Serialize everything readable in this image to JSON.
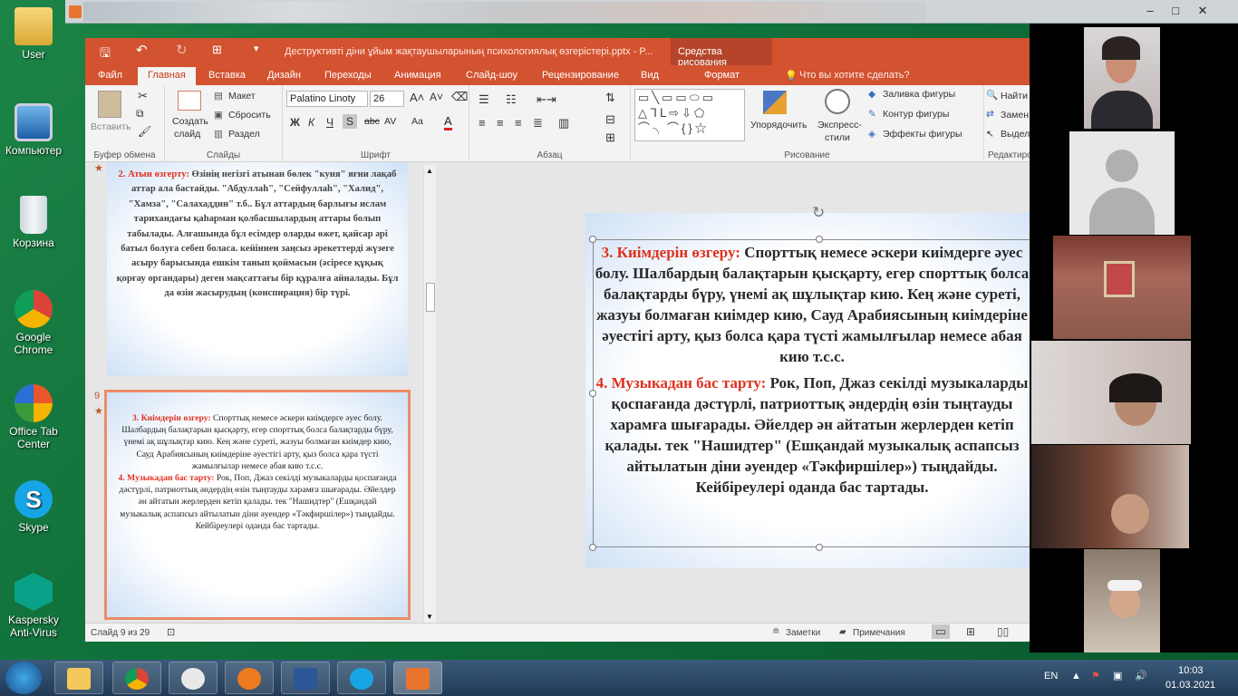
{
  "desktop": {
    "icons": [
      {
        "label": "User"
      },
      {
        "label": "Компьютер"
      },
      {
        "label": "Корзина"
      },
      {
        "label": "Google\nChrome"
      },
      {
        "label": "Office Tab\nCenter"
      },
      {
        "label": "Skype"
      },
      {
        "label": "Kaspersky\nAnti-Virus"
      }
    ]
  },
  "ppt": {
    "doc_title": "Деструктивті діни ұйым жақтаушыларының психологиялық өзгерістері.pptx - P...",
    "context_group": "Средства рисования",
    "tabs": [
      "Файл",
      "Главная",
      "Вставка",
      "Дизайн",
      "Переходы",
      "Анимация",
      "Слайд-шоу",
      "Рецензирование",
      "Вид",
      "Формат"
    ],
    "tell_me": "Что вы хотите сделать?",
    "ribbon": {
      "clipboard": {
        "paste": "Вставить",
        "label": "Буфер обмена"
      },
      "slides": {
        "create": "Создать",
        "slide": "слайд",
        "layout": "Макет",
        "reset": "Сбросить",
        "section": "Раздел",
        "label": "Слайды"
      },
      "font": {
        "name": "Palatino Linoty",
        "size": "26",
        "label": "Шрифт",
        "bold": "Ж",
        "italic": "К",
        "underline": "Ч",
        "shadow": "S",
        "strike": "abc",
        "spacing": "AV",
        "case": "Aa"
      },
      "paragraph": {
        "label": "Абзац"
      },
      "drawing": {
        "arrange": "Упорядочить",
        "styles1": "Экспресс-",
        "styles2": "стили",
        "fill": "Заливка фигуры",
        "outline": "Контур фигуры",
        "effects": "Эффекты фигуры",
        "label": "Рисование"
      },
      "editing": {
        "find": "Найти",
        "replace": "Замен",
        "select": "Выдел",
        "label": "Редактиров"
      }
    },
    "thumb8": {
      "heading": "2. Атын өзгерту:",
      "text": " Өзінің негізгі атынан бөлек \"куня\" яғни лақаб аттар ала бастайды. \"Абдуллаh\", \"Сейфуллаh\", \"Халид\", \"Хамза\", \"Салахаддин\" т.б.. Бұл аттардың барлығы ислам тарихандағы қаһарман қолбасшылардың аттары болып табылады. Алғашында бұл есімдер оларды өжет, қайсар әрі батыл болуға себеп боласа. кейіннен заңсыз әрекеттерді жүзеге асыру барысында ешкім танып қоймасын (әсіресе құқық қорғау органдары) деген мақсаттағы бір құралға айналады. Бұл да өзін жасырудың (конспирация) бір түрі."
    },
    "slide9": {
      "number": "9",
      "p1_heading": "3. Киімдерін өзгеру:",
      "p1_text": " Спорттық немесе әскери киімдерге әуес болу. Шалбардың балақтарын қысқарту, егер спорттық болса балақтарды бүру, үнемі ақ шұлықтар кию. Кең және суреті, жазуы болмаған киімдер кию, Сауд Арабиясының киімдеріне әуестігі арту, қыз болса қара түсті жамылғылар немесе абая кию т.с.с.",
      "p2_heading": "4. Музыкадан бас тарту:",
      "p2_text": " Рок, Поп, Джаз секілді музыкаларды қоспағанда дәстүрлі, патриоттық әндердің өзін тыңтауды харамға шығарады. Әйелдер ән айтатын жерлерден кетіп қалады. тек \"Нашидтер\" (Ешқандай музыкалық аспапсыз айтылатын діни әуендер «Тәкфиршілер») тыңдайды. Кейбіреулері оданда бас тартады."
    },
    "status": {
      "slide_of": "Слайд 9 из 29",
      "notes": "Заметки",
      "comments": "Примечания"
    }
  },
  "taskbar": {
    "lang": "EN",
    "time": "10:03",
    "date": "01.03.2021"
  },
  "colors": {
    "accent": "#d35230",
    "heading_red": "#e0301e",
    "desktop": "#0f6e3a"
  }
}
